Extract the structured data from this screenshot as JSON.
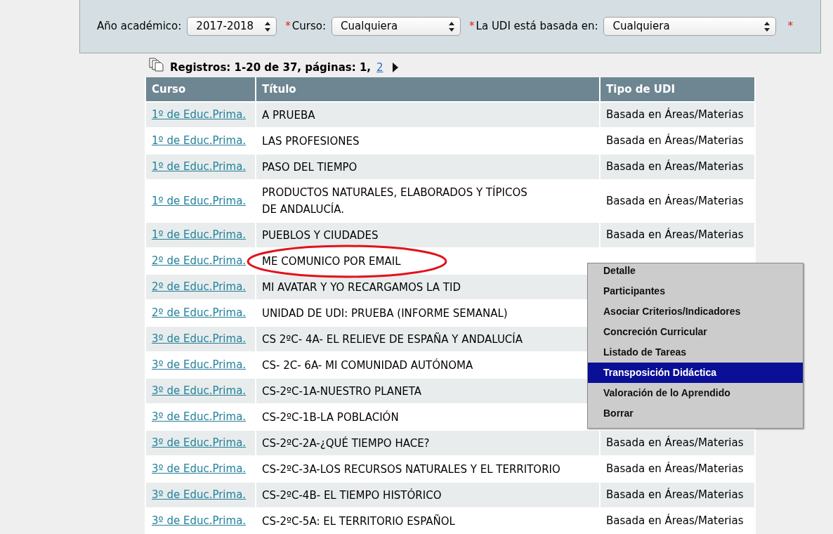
{
  "filters": {
    "fields": [
      {
        "label": "Año académico:",
        "value": "2017-2018"
      },
      {
        "mark": "*",
        "label": "Curso:",
        "value": "Cualquiera"
      },
      {
        "mark": "*",
        "label": "La UDI está basada en:",
        "value": "Cualquiera"
      }
    ],
    "trailing_mark": "*"
  },
  "pager": {
    "summary": "Registros: 1-20 de 37, páginas: 1,",
    "pages": [
      {
        "label": "2",
        "selected": false
      }
    ]
  },
  "table": {
    "columns": [
      "Curso",
      "Título",
      "Tipo de UDI"
    ],
    "rows": [
      {
        "curso": "1º de Educ.Prima.",
        "titulo": "A PRUEBA",
        "tipo": "Basada en Áreas/Materias",
        "circled": false
      },
      {
        "curso": "1º de Educ.Prima.",
        "titulo": "LAS PROFESIONES",
        "tipo": "Basada en Áreas/Materias",
        "circled": false
      },
      {
        "curso": "1º de Educ.Prima.",
        "titulo": "PASO DEL TIEMPO",
        "tipo": "Basada en Áreas/Materias",
        "circled": false
      },
      {
        "curso": "1º de Educ.Prima.",
        "titulo": "PRODUCTOS NATURALES, ELABORADOS Y TÍPICOS\nDE ANDALUCÍA.",
        "tipo": "Basada en Áreas/Materias",
        "circled": false
      },
      {
        "curso": "1º de Educ.Prima.",
        "titulo": "PUEBLOS Y CIUDADES",
        "tipo": "Basada en Áreas/Materias",
        "circled": false
      },
      {
        "curso": "2º de Educ.Prima.",
        "titulo": "ME COMUNICO POR EMAIL",
        "circled": true
      },
      {
        "curso": "2º de Educ.Prima.",
        "titulo": "MI AVATAR Y YO RECARGAMOS LA TID",
        "circled": false
      },
      {
        "curso": "2º de Educ.Prima.",
        "titulo": "UNIDAD DE UDI: PRUEBA (INFORME SEMANAL)",
        "circled": false
      },
      {
        "curso": "3º de Educ.Prima.",
        "titulo": "CS 2ºC- 4A- EL RELIEVE DE ESPAÑA Y ANDALUCÍA",
        "circled": false
      },
      {
        "curso": "3º de Educ.Prima.",
        "titulo": "CS- 2C- 6A- MI COMUNIDAD AUTÓNOMA",
        "circled": false
      },
      {
        "curso": "3º de Educ.Prima.",
        "titulo": "CS-2ºC-1A-NUESTRO PLANETA",
        "circled": false
      },
      {
        "curso": "3º de Educ.Prima.",
        "titulo": "CS-2ºC-1B-LA POBLACIÓN",
        "circled": false
      },
      {
        "curso": "3º de Educ.Prima.",
        "titulo": "CS-2ºC-2A-¿QUÉ TIEMPO HACE?",
        "tipo": "Basada en Áreas/Materias",
        "circled": false
      },
      {
        "curso": "3º de Educ.Prima.",
        "titulo": "CS-2ºC-3A-LOS RECURSOS NATURALES Y EL TERRITORIO",
        "tipo": "Basada en Áreas/Materias",
        "circled": false
      },
      {
        "curso": "3º de Educ.Prima.",
        "titulo": "CS-2ºC-4B- EL TIEMPO HISTÓRICO",
        "tipo": "Basada en Áreas/Materias",
        "circled": false
      },
      {
        "curso": "3º de Educ.Prima.",
        "titulo": "CS-2ºC-5A: EL TERRITORIO ESPAÑOL",
        "tipo": "Basada en Áreas/Materias",
        "circled": false
      }
    ]
  },
  "context_menu": {
    "items": [
      {
        "label": "Detalle",
        "selected": false
      },
      {
        "label": "Participantes",
        "selected": false
      },
      {
        "label": "Asociar Criterios/Indicadores",
        "selected": false
      },
      {
        "label": "Concreción Curricular",
        "selected": false
      },
      {
        "label": "Listado de Tareas",
        "selected": false
      },
      {
        "label": "Transposición Didáctica",
        "selected": true
      },
      {
        "label": "Valoración de lo Aprendido",
        "selected": false
      },
      {
        "label": "Borrar",
        "selected": false
      }
    ]
  }
}
